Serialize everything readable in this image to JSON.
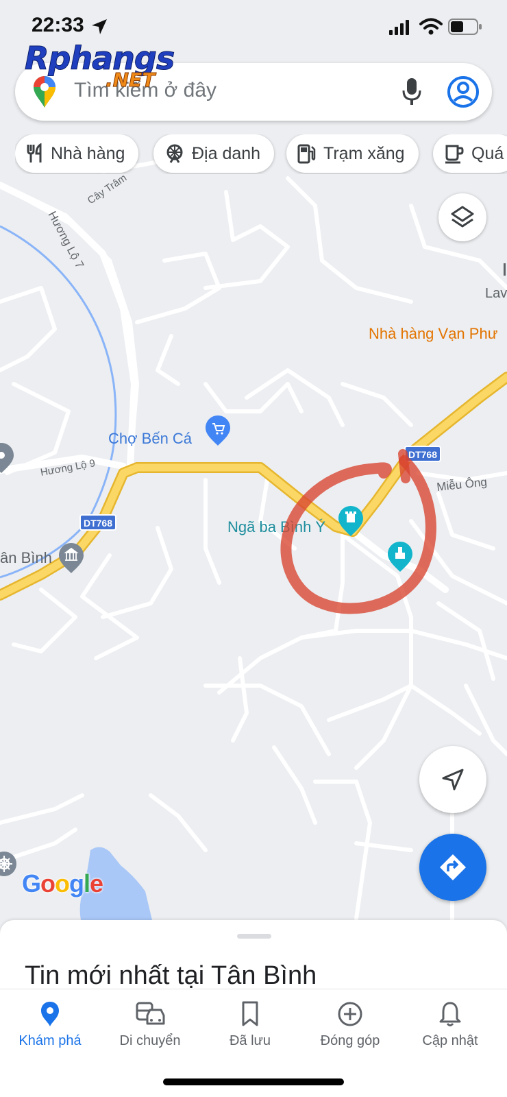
{
  "status_bar": {
    "time": "22:33"
  },
  "watermark": {
    "main": "Rphangs",
    "suffix": ".NET"
  },
  "search": {
    "placeholder": "Tìm kiếm ở đây"
  },
  "chips": [
    {
      "label": "Nhà hàng",
      "icon": "restaurant-icon"
    },
    {
      "label": "Địa danh",
      "icon": "attraction-icon"
    },
    {
      "label": "Trạm xăng",
      "icon": "gas-station-icon"
    },
    {
      "label": "Quá",
      "icon": "coffee-icon"
    }
  ],
  "map": {
    "road_labels": {
      "huong_lo_7": "Hương Lộ 7",
      "cay_tram": "Cây Trâm",
      "huong_lo_9": "Hương Lộ 9",
      "mieu_ong": "Miễu Ông"
    },
    "route_shields": {
      "dt768_right": "DT768",
      "dt768_left": "DT768"
    },
    "places": {
      "cho_ben_ca": "Chợ Bến Cá",
      "nga_ba_binh_y": "Ngã ba Bình Ý",
      "tan_binh": "ân Bình",
      "nha_hang_van_phu": "Nhà hàng Vạn Phư",
      "lav": "Lav"
    },
    "annotation_color": "#d8442f"
  },
  "google_logo": {
    "G": "G",
    "o1": "o",
    "o2": "o",
    "g": "g",
    "l": "l",
    "e": "e"
  },
  "sheet": {
    "title": "Tin mới nhất tại Tân Bình"
  },
  "nav": {
    "items": [
      {
        "label": "Khám phá",
        "icon": "explore-pin-icon",
        "active": true
      },
      {
        "label": "Di chuyển",
        "icon": "commute-icon",
        "active": false
      },
      {
        "label": "Đã lưu",
        "icon": "bookmark-icon",
        "active": false
      },
      {
        "label": "Đóng góp",
        "icon": "add-circle-icon",
        "active": false
      },
      {
        "label": "Cập nhật",
        "icon": "bell-icon",
        "active": false
      }
    ]
  },
  "colors": {
    "accent": "#1a73e8",
    "highway": "#f5c842",
    "poi_teal": "#12b5cb",
    "label_blue": "#3b78d8",
    "restaurant_label": "#e37400"
  }
}
